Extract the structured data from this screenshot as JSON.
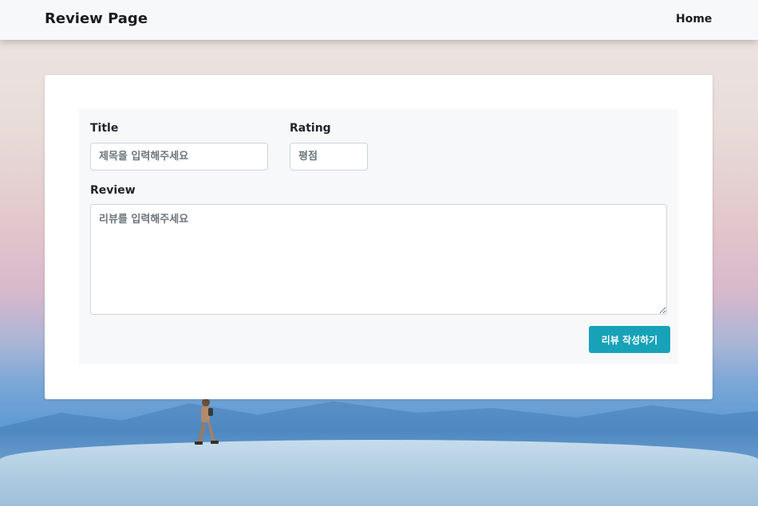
{
  "navbar": {
    "brand": "Review Page",
    "home_link": "Home"
  },
  "form": {
    "title_label": "Title",
    "title_placeholder": "제목을 입력해주세요",
    "rating_label": "Rating",
    "rating_placeholder": "평점",
    "review_label": "Review",
    "review_placeholder": "리뷰를 입력해주세요",
    "submit_label": "리뷰 작성하기"
  },
  "colors": {
    "navbar_bg": "#f7f8fa",
    "submit_button": "#17a2b8",
    "panel_bg": "#f7f8fa"
  }
}
